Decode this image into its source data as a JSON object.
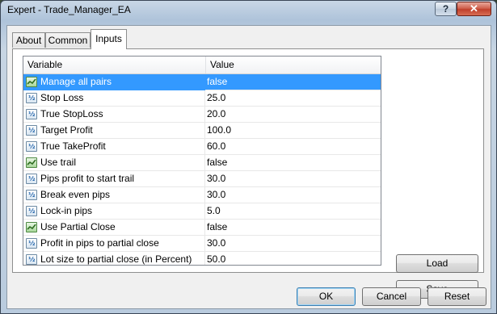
{
  "window": {
    "title": "Expert - Trade_Manager_EA"
  },
  "title_buttons": {
    "help": "?",
    "close": "✕"
  },
  "tabs": [
    {
      "label": "About",
      "active": false
    },
    {
      "label": "Common",
      "active": false
    },
    {
      "label": "Inputs",
      "active": true
    }
  ],
  "grid": {
    "columns": [
      "Variable",
      "Value"
    ],
    "rows": [
      {
        "icon": "bool-param-icon",
        "type": "bool",
        "variable": "Manage all pairs",
        "value": "false",
        "selected": true
      },
      {
        "icon": "numeric-param-icon",
        "type": "num",
        "variable": "Stop Loss",
        "value": "25.0"
      },
      {
        "icon": "numeric-param-icon",
        "type": "num",
        "variable": "True StopLoss",
        "value": "20.0"
      },
      {
        "icon": "numeric-param-icon",
        "type": "num",
        "variable": "Target Profit",
        "value": "100.0"
      },
      {
        "icon": "numeric-param-icon",
        "type": "num",
        "variable": "True TakeProfit",
        "value": "60.0"
      },
      {
        "icon": "bool-param-icon",
        "type": "bool",
        "variable": "Use trail",
        "value": "false"
      },
      {
        "icon": "numeric-param-icon",
        "type": "num",
        "variable": "Pips profit to start trail",
        "value": "30.0"
      },
      {
        "icon": "numeric-param-icon",
        "type": "num",
        "variable": "Break even pips",
        "value": "30.0"
      },
      {
        "icon": "numeric-param-icon",
        "type": "num",
        "variable": "Lock-in pips",
        "value": "5.0"
      },
      {
        "icon": "bool-param-icon",
        "type": "bool",
        "variable": "Use Partial Close",
        "value": "false"
      },
      {
        "icon": "numeric-param-icon",
        "type": "num",
        "variable": "Profit in pips to partial close",
        "value": "30.0"
      },
      {
        "icon": "numeric-param-icon",
        "type": "num",
        "variable": "Lot size to partial close (in Percent)",
        "value": "50.0"
      }
    ]
  },
  "side_buttons": {
    "load": "Load",
    "save": "Save"
  },
  "footer_buttons": {
    "ok": "OK",
    "cancel": "Cancel",
    "reset": "Reset"
  },
  "colors": {
    "selection": "#3399ff",
    "close_button": "#c0402b"
  }
}
